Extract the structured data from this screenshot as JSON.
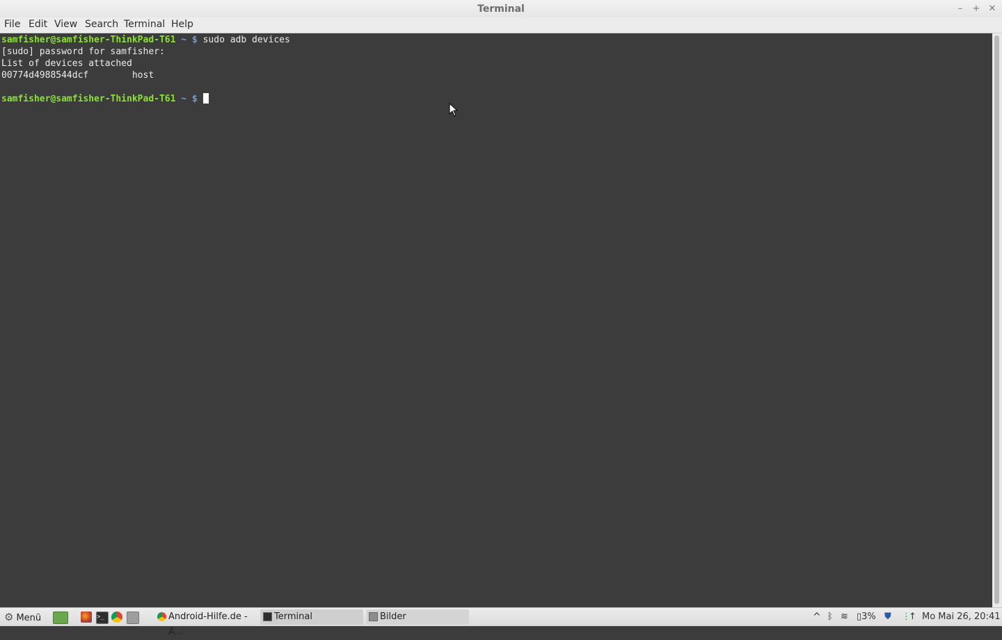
{
  "window": {
    "title": "Terminal"
  },
  "menubar": {
    "items": [
      "File",
      "Edit",
      "View",
      "Search",
      "Terminal",
      "Help"
    ]
  },
  "terminal": {
    "lines": [
      {
        "user": "samfisher@samfisher-ThinkPad-T61",
        "path": " ~ $",
        "cmd": " sudo adb devices"
      },
      {
        "text": "[sudo] password for samfisher:"
      },
      {
        "text": "List of devices attached"
      },
      {
        "text": "00774d4988544dcf\thost"
      },
      {
        "text": ""
      },
      {
        "user": "samfisher@samfisher-ThinkPad-T61",
        "path": " ~ $",
        "cmd": " "
      }
    ],
    "colors": {
      "background": "#3c3c3c",
      "user": "#8ae234",
      "path": "#729fcf",
      "text": "#ececec"
    }
  },
  "taskbar": {
    "menu_label": "Menü",
    "windows": [
      {
        "label": "Android-Hilfe.de - A...",
        "icon": "chrome-icon"
      },
      {
        "label": "Terminal",
        "icon": "terminal-icon"
      },
      {
        "label": "Bilder",
        "icon": "folder-icon"
      }
    ],
    "tray": {
      "battery": "3%",
      "clock": "Mo Mai 26, 20:41"
    }
  }
}
